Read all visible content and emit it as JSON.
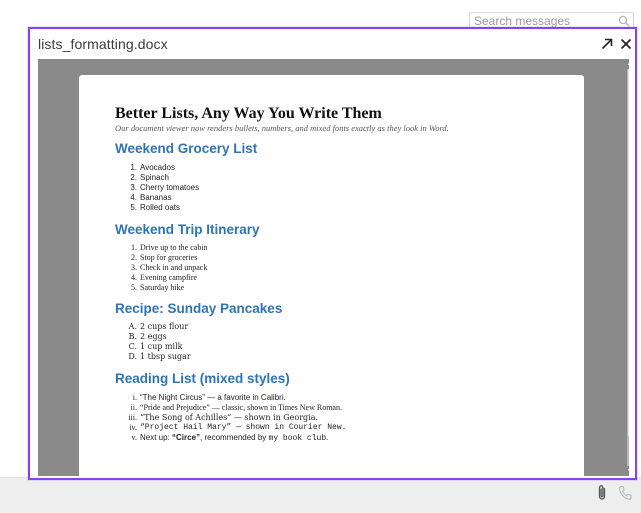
{
  "search": {
    "placeholder": "Search messages"
  },
  "modal": {
    "title": "lists_formatting.docx"
  },
  "doc": {
    "title": "Better Lists, Any Way You Write Them",
    "subtitle": "Our document viewer now renders bullets, numbers, and mixed fonts exactly as they look in Word.",
    "sections": [
      {
        "heading": "Weekend Grocery List",
        "items": [
          {
            "marker": "1.",
            "text": "Avocados"
          },
          {
            "marker": "2.",
            "text": "Spinach"
          },
          {
            "marker": "3.",
            "text": "Cherry tomatoes"
          },
          {
            "marker": "4.",
            "text": "Bananas"
          },
          {
            "marker": "5.",
            "text": "Rolled oats"
          }
        ]
      },
      {
        "heading": "Weekend Trip Itinerary",
        "items": [
          {
            "marker": "1.",
            "text": "Drive up to the cabin"
          },
          {
            "marker": "2.",
            "text": "Stop for groceries"
          },
          {
            "marker": "3.",
            "text": "Check in and unpack"
          },
          {
            "marker": "4.",
            "text": "Evening campfire"
          },
          {
            "marker": "5.",
            "text": "Saturday hike"
          }
        ]
      },
      {
        "heading": "Recipe: Sunday Pancakes",
        "items": [
          {
            "marker": "A.",
            "text": "2 cups flour"
          },
          {
            "marker": "B.",
            "text": "2 eggs"
          },
          {
            "marker": "C.",
            "text": "1 cup milk"
          },
          {
            "marker": "D.",
            "text": "1 tbsp sugar"
          }
        ]
      },
      {
        "heading": "Reading List (mixed styles)",
        "items": [
          {
            "marker": "i.",
            "text": "“The Night Circus” — a favorite in Calibri."
          },
          {
            "marker": "ii.",
            "text": "“Pride and Prejudice” — classic, shown in Times New Roman."
          },
          {
            "marker": "iii.",
            "text": "“The Song of Achilles” — shown in Georgia."
          },
          {
            "marker": "iv.",
            "text": "“Project Hail Mary” — shown in Courier New."
          },
          {
            "marker": "v.",
            "prefix": "Next up: ",
            "bold": "“Circe”",
            "middle": ", recommended by ",
            "mono": "my book club",
            "suffix": "."
          }
        ]
      }
    ]
  }
}
